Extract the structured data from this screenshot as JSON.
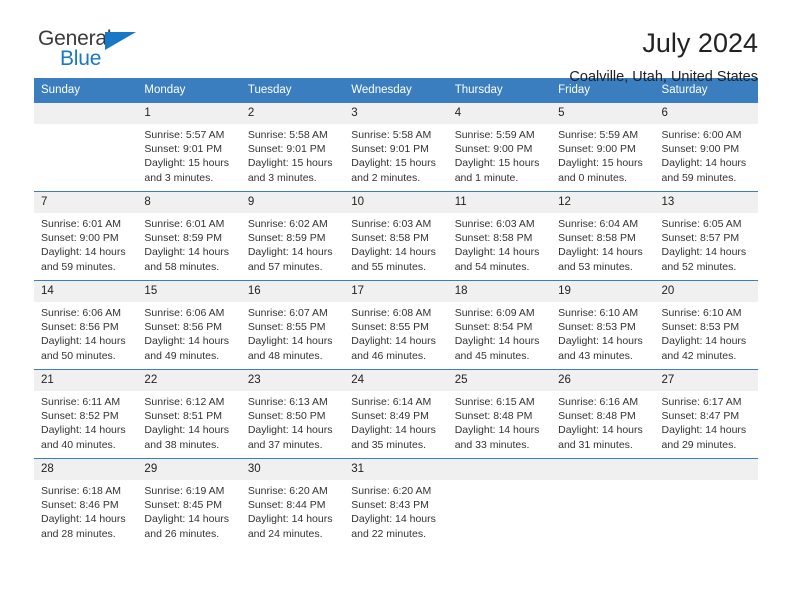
{
  "brand": {
    "name_top": "General",
    "name_bottom": "Blue",
    "triangle_icon": "brand-triangle-icon",
    "accent_color": "#1878c8"
  },
  "header": {
    "title": "July 2024",
    "subtitle": "Coalville, Utah, United States"
  },
  "theme": {
    "header_row_bg": "#3a7ebf",
    "daynum_bg": "#f0f0f0",
    "grid_line": "#3a7ebf",
    "text": "#333333"
  },
  "weekdays": [
    "Sunday",
    "Monday",
    "Tuesday",
    "Wednesday",
    "Thursday",
    "Friday",
    "Saturday"
  ],
  "labels": {
    "sunrise": "Sunrise:",
    "sunset": "Sunset:",
    "daylight": "Daylight:"
  },
  "weeks": [
    [
      {
        "day": "",
        "sunrise": "",
        "sunset": "",
        "daylight_1": "",
        "daylight_2": "",
        "blank": true
      },
      {
        "day": "1",
        "sunrise": "Sunrise: 5:57 AM",
        "sunset": "Sunset: 9:01 PM",
        "daylight_1": "Daylight: 15 hours",
        "daylight_2": "and 3 minutes."
      },
      {
        "day": "2",
        "sunrise": "Sunrise: 5:58 AM",
        "sunset": "Sunset: 9:01 PM",
        "daylight_1": "Daylight: 15 hours",
        "daylight_2": "and 3 minutes."
      },
      {
        "day": "3",
        "sunrise": "Sunrise: 5:58 AM",
        "sunset": "Sunset: 9:01 PM",
        "daylight_1": "Daylight: 15 hours",
        "daylight_2": "and 2 minutes."
      },
      {
        "day": "4",
        "sunrise": "Sunrise: 5:59 AM",
        "sunset": "Sunset: 9:00 PM",
        "daylight_1": "Daylight: 15 hours",
        "daylight_2": "and 1 minute."
      },
      {
        "day": "5",
        "sunrise": "Sunrise: 5:59 AM",
        "sunset": "Sunset: 9:00 PM",
        "daylight_1": "Daylight: 15 hours",
        "daylight_2": "and 0 minutes."
      },
      {
        "day": "6",
        "sunrise": "Sunrise: 6:00 AM",
        "sunset": "Sunset: 9:00 PM",
        "daylight_1": "Daylight: 14 hours",
        "daylight_2": "and 59 minutes."
      }
    ],
    [
      {
        "day": "7",
        "sunrise": "Sunrise: 6:01 AM",
        "sunset": "Sunset: 9:00 PM",
        "daylight_1": "Daylight: 14 hours",
        "daylight_2": "and 59 minutes."
      },
      {
        "day": "8",
        "sunrise": "Sunrise: 6:01 AM",
        "sunset": "Sunset: 8:59 PM",
        "daylight_1": "Daylight: 14 hours",
        "daylight_2": "and 58 minutes."
      },
      {
        "day": "9",
        "sunrise": "Sunrise: 6:02 AM",
        "sunset": "Sunset: 8:59 PM",
        "daylight_1": "Daylight: 14 hours",
        "daylight_2": "and 57 minutes."
      },
      {
        "day": "10",
        "sunrise": "Sunrise: 6:03 AM",
        "sunset": "Sunset: 8:58 PM",
        "daylight_1": "Daylight: 14 hours",
        "daylight_2": "and 55 minutes."
      },
      {
        "day": "11",
        "sunrise": "Sunrise: 6:03 AM",
        "sunset": "Sunset: 8:58 PM",
        "daylight_1": "Daylight: 14 hours",
        "daylight_2": "and 54 minutes."
      },
      {
        "day": "12",
        "sunrise": "Sunrise: 6:04 AM",
        "sunset": "Sunset: 8:58 PM",
        "daylight_1": "Daylight: 14 hours",
        "daylight_2": "and 53 minutes."
      },
      {
        "day": "13",
        "sunrise": "Sunrise: 6:05 AM",
        "sunset": "Sunset: 8:57 PM",
        "daylight_1": "Daylight: 14 hours",
        "daylight_2": "and 52 minutes."
      }
    ],
    [
      {
        "day": "14",
        "sunrise": "Sunrise: 6:06 AM",
        "sunset": "Sunset: 8:56 PM",
        "daylight_1": "Daylight: 14 hours",
        "daylight_2": "and 50 minutes."
      },
      {
        "day": "15",
        "sunrise": "Sunrise: 6:06 AM",
        "sunset": "Sunset: 8:56 PM",
        "daylight_1": "Daylight: 14 hours",
        "daylight_2": "and 49 minutes."
      },
      {
        "day": "16",
        "sunrise": "Sunrise: 6:07 AM",
        "sunset": "Sunset: 8:55 PM",
        "daylight_1": "Daylight: 14 hours",
        "daylight_2": "and 48 minutes."
      },
      {
        "day": "17",
        "sunrise": "Sunrise: 6:08 AM",
        "sunset": "Sunset: 8:55 PM",
        "daylight_1": "Daylight: 14 hours",
        "daylight_2": "and 46 minutes."
      },
      {
        "day": "18",
        "sunrise": "Sunrise: 6:09 AM",
        "sunset": "Sunset: 8:54 PM",
        "daylight_1": "Daylight: 14 hours",
        "daylight_2": "and 45 minutes."
      },
      {
        "day": "19",
        "sunrise": "Sunrise: 6:10 AM",
        "sunset": "Sunset: 8:53 PM",
        "daylight_1": "Daylight: 14 hours",
        "daylight_2": "and 43 minutes."
      },
      {
        "day": "20",
        "sunrise": "Sunrise: 6:10 AM",
        "sunset": "Sunset: 8:53 PM",
        "daylight_1": "Daylight: 14 hours",
        "daylight_2": "and 42 minutes."
      }
    ],
    [
      {
        "day": "21",
        "sunrise": "Sunrise: 6:11 AM",
        "sunset": "Sunset: 8:52 PM",
        "daylight_1": "Daylight: 14 hours",
        "daylight_2": "and 40 minutes."
      },
      {
        "day": "22",
        "sunrise": "Sunrise: 6:12 AM",
        "sunset": "Sunset: 8:51 PM",
        "daylight_1": "Daylight: 14 hours",
        "daylight_2": "and 38 minutes."
      },
      {
        "day": "23",
        "sunrise": "Sunrise: 6:13 AM",
        "sunset": "Sunset: 8:50 PM",
        "daylight_1": "Daylight: 14 hours",
        "daylight_2": "and 37 minutes."
      },
      {
        "day": "24",
        "sunrise": "Sunrise: 6:14 AM",
        "sunset": "Sunset: 8:49 PM",
        "daylight_1": "Daylight: 14 hours",
        "daylight_2": "and 35 minutes."
      },
      {
        "day": "25",
        "sunrise": "Sunrise: 6:15 AM",
        "sunset": "Sunset: 8:48 PM",
        "daylight_1": "Daylight: 14 hours",
        "daylight_2": "and 33 minutes."
      },
      {
        "day": "26",
        "sunrise": "Sunrise: 6:16 AM",
        "sunset": "Sunset: 8:48 PM",
        "daylight_1": "Daylight: 14 hours",
        "daylight_2": "and 31 minutes."
      },
      {
        "day": "27",
        "sunrise": "Sunrise: 6:17 AM",
        "sunset": "Sunset: 8:47 PM",
        "daylight_1": "Daylight: 14 hours",
        "daylight_2": "and 29 minutes."
      }
    ],
    [
      {
        "day": "28",
        "sunrise": "Sunrise: 6:18 AM",
        "sunset": "Sunset: 8:46 PM",
        "daylight_1": "Daylight: 14 hours",
        "daylight_2": "and 28 minutes."
      },
      {
        "day": "29",
        "sunrise": "Sunrise: 6:19 AM",
        "sunset": "Sunset: 8:45 PM",
        "daylight_1": "Daylight: 14 hours",
        "daylight_2": "and 26 minutes."
      },
      {
        "day": "30",
        "sunrise": "Sunrise: 6:20 AM",
        "sunset": "Sunset: 8:44 PM",
        "daylight_1": "Daylight: 14 hours",
        "daylight_2": "and 24 minutes."
      },
      {
        "day": "31",
        "sunrise": "Sunrise: 6:20 AM",
        "sunset": "Sunset: 8:43 PM",
        "daylight_1": "Daylight: 14 hours",
        "daylight_2": "and 22 minutes."
      },
      {
        "day": "",
        "sunrise": "",
        "sunset": "",
        "daylight_1": "",
        "daylight_2": "",
        "blank": true
      },
      {
        "day": "",
        "sunrise": "",
        "sunset": "",
        "daylight_1": "",
        "daylight_2": "",
        "blank": true
      },
      {
        "day": "",
        "sunrise": "",
        "sunset": "",
        "daylight_1": "",
        "daylight_2": "",
        "blank": true
      }
    ]
  ]
}
